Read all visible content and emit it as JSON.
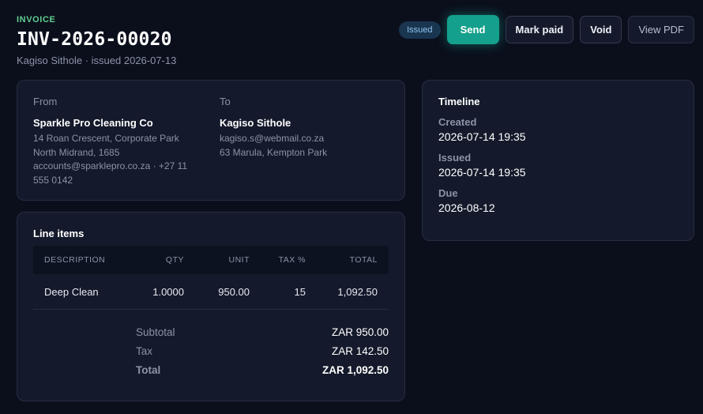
{
  "header": {
    "eyebrow": "INVOICE",
    "number": "INV-2026-00020",
    "subtitle": "Kagiso Sithole · issued 2026-07-13"
  },
  "actions": {
    "status_badge": "Issued",
    "send_label": "Send",
    "mark_paid_label": "Mark paid",
    "void_label": "Void",
    "view_pdf_label": "View PDF"
  },
  "parties": {
    "from": {
      "label": "From",
      "name": "Sparkle Pro Cleaning Co",
      "address1": "14 Roan Crescent, Corporate Park",
      "address2": "North Midrand, 1685",
      "contact": "accounts@sparklepro.co.za · +27 11 555 0142"
    },
    "to": {
      "label": "To",
      "name": "Kagiso Sithole",
      "email": "kagiso.s@webmail.co.za",
      "address": "63 Marula, Kempton Park"
    }
  },
  "line_items": {
    "title": "Line items",
    "columns": [
      "DESCRIPTION",
      "QTY",
      "UNIT",
      "TAX %",
      "TOTAL"
    ],
    "rows": [
      {
        "description": "Deep Clean",
        "qty": "1.0000",
        "unit": "950.00",
        "tax": "15",
        "total": "1,092.50"
      }
    ],
    "totals": {
      "subtotal_label": "Subtotal",
      "subtotal": "ZAR 950.00",
      "tax_label": "Tax",
      "tax": "ZAR 142.50",
      "total_label": "Total",
      "total": "ZAR 1,092.50"
    }
  },
  "timeline": {
    "title": "Timeline",
    "entries": [
      {
        "label": "Created",
        "value": "2026-07-14 19:35"
      },
      {
        "label": "Issued",
        "value": "2026-07-14 19:35"
      },
      {
        "label": "Due",
        "value": "2026-08-12"
      }
    ]
  },
  "colors": {
    "background": "#0b0f1c",
    "card": "#141a2b",
    "accent": "#14a08c",
    "eyebrow": "#5fcf8f",
    "badge": "#1a3550"
  }
}
